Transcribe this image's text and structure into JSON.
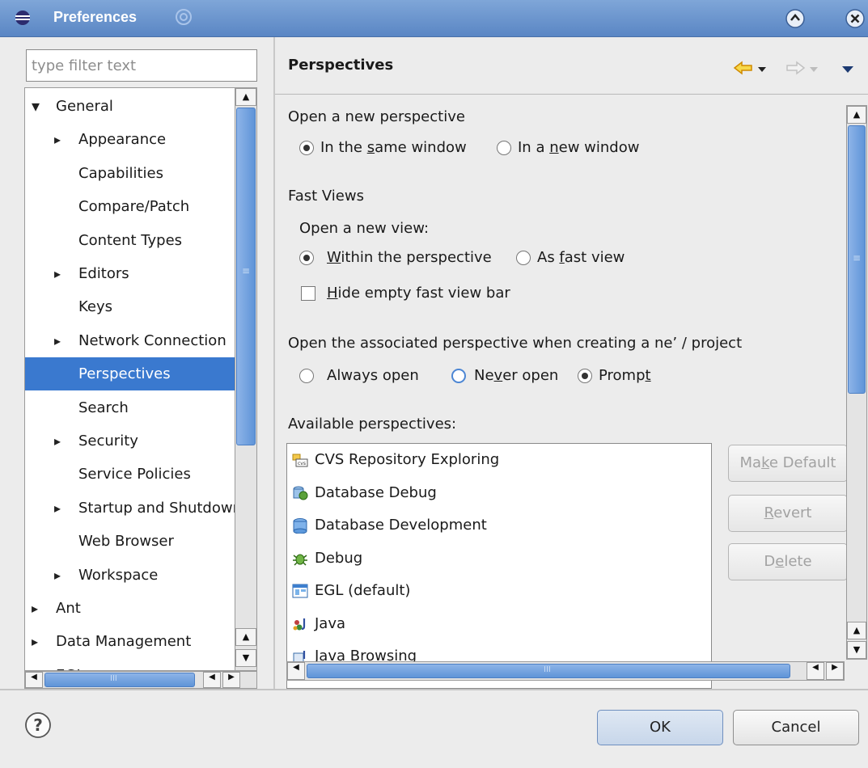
{
  "window": {
    "title": "Preferences"
  },
  "filter": {
    "placeholder": "type filter text"
  },
  "tree": {
    "items": [
      {
        "label": "General",
        "expander": "expanded"
      },
      {
        "label": "Appearance",
        "expander": "collapsed"
      },
      {
        "label": "Capabilities",
        "expander": ""
      },
      {
        "label": "Compare/Patch",
        "expander": ""
      },
      {
        "label": "Content Types",
        "expander": ""
      },
      {
        "label": "Editors",
        "expander": "collapsed"
      },
      {
        "label": "Keys",
        "expander": ""
      },
      {
        "label": "Network Connection",
        "expander": "collapsed"
      },
      {
        "label": "Perspectives",
        "expander": "",
        "selected": true
      },
      {
        "label": "Search",
        "expander": ""
      },
      {
        "label": "Security",
        "expander": "collapsed"
      },
      {
        "label": "Service Policies",
        "expander": ""
      },
      {
        "label": "Startup and Shutdown",
        "expander": "collapsed"
      },
      {
        "label": "Web Browser",
        "expander": ""
      },
      {
        "label": "Workspace",
        "expander": "collapsed"
      },
      {
        "label": "Ant",
        "expander": "collapsed"
      },
      {
        "label": "Data Management",
        "expander": "collapsed"
      },
      {
        "label": "EGL",
        "expander": "collapsed"
      }
    ]
  },
  "page": {
    "title": "Perspectives"
  },
  "open_perspective": {
    "heading": "Open a new perspective",
    "same_window": {
      "pre": "In the ",
      "key": "s",
      "post": "ame window"
    },
    "new_window": {
      "pre": "In a ",
      "key": "n",
      "post": "ew window"
    }
  },
  "fast_views": {
    "heading": "Fast Views",
    "subheading": "Open a new view:",
    "within": {
      "pre": "",
      "key": "W",
      "post": "ithin the perspective"
    },
    "as_fast": {
      "pre": "As ",
      "key": "f",
      "post": "ast view"
    },
    "hide_bar": {
      "pre": "",
      "key": "H",
      "post": "ide empty fast view bar"
    }
  },
  "associated": {
    "heading": "Open the associated perspective when creating a ne’ / project",
    "always": "Always open",
    "never": {
      "pre": "Ne",
      "key": "v",
      "post": "er open"
    },
    "prompt": {
      "pre": "Promp",
      "key": "t",
      "post": ""
    }
  },
  "available": {
    "heading": "Available perspectives:",
    "items": [
      {
        "label": "CVS Repository Exploring",
        "icon": "cvs-icon"
      },
      {
        "label": "Database Debug",
        "icon": "database-debug-icon"
      },
      {
        "label": "Database Development",
        "icon": "database-icon"
      },
      {
        "label": "Debug",
        "icon": "debug-bug-icon"
      },
      {
        "label": "EGL (default)",
        "icon": "egl-icon"
      },
      {
        "label": "Java",
        "icon": "java-icon"
      },
      {
        "label": "Java Browsing",
        "icon": "java-browsing-icon"
      }
    ]
  },
  "side_buttons": {
    "make_default": {
      "pre": "Ma",
      "key": "k",
      "post": "e Default"
    },
    "revert": {
      "pre": "",
      "key": "R",
      "post": "evert"
    },
    "delete": {
      "pre": "D",
      "key": "e",
      "post": "lete"
    }
  },
  "scroll_glyphs": {
    "grip": "≡",
    "hgrip": "III"
  },
  "footer": {
    "ok": "OK",
    "cancel": "Cancel"
  },
  "colors": {
    "selection": "#3a79cf",
    "titlebar": "#6a94ce",
    "scroll_thumb": "#5f94d8",
    "nav_arrow": "#f0a500"
  }
}
